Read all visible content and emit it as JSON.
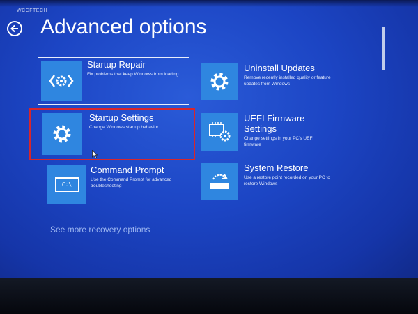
{
  "watermark": "WCCFTECH",
  "page": {
    "title": "Advanced options"
  },
  "tiles": [
    {
      "id": "startup-repair",
      "title": "Startup Repair",
      "description": "Fix problems that keep Windows from loading",
      "icon": "code-gear-icon",
      "state": "focused"
    },
    {
      "id": "startup-settings",
      "title": "Startup Settings",
      "description": "Change Windows startup behavior",
      "icon": "gear-icon",
      "state": "highlighted"
    },
    {
      "id": "command-prompt",
      "title": "Command Prompt",
      "description": "Use the Command Prompt for advanced troubleshooting",
      "icon": "terminal-icon",
      "icon_text": "C:\\",
      "state": "normal"
    },
    {
      "id": "uninstall-updates",
      "title": "Uninstall Updates",
      "description": "Remove recently installed quality or feature updates from Windows",
      "icon": "gear-icon",
      "state": "normal"
    },
    {
      "id": "uefi-firmware",
      "title": "UEFI Firmware Settings",
      "description": "Change settings in your PC's UEFI firmware",
      "icon": "chip-gear-icon",
      "state": "normal"
    },
    {
      "id": "system-restore",
      "title": "System Restore",
      "description": "Use a restore point recorded on your PC to restore Windows",
      "icon": "restore-icon",
      "state": "normal"
    }
  ],
  "more_link": "See more recovery options",
  "colors": {
    "background": "#1c45c4",
    "tile_icon": "#2f86e0",
    "focus_border": "#e9eefc",
    "highlight_border": "#d8262b",
    "link": "#9ab4f0"
  }
}
